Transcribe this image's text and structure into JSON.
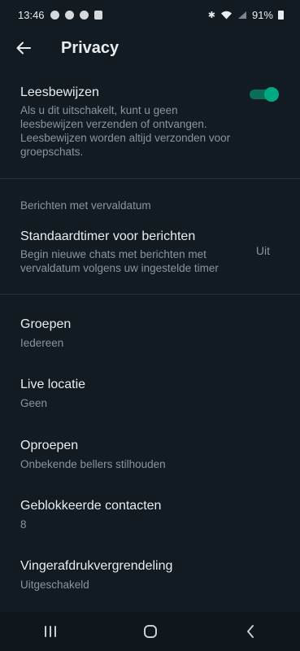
{
  "status": {
    "time": "13:46",
    "battery": "91%"
  },
  "header": {
    "title": "Privacy"
  },
  "read_receipts": {
    "title": "Leesbewijzen",
    "description": "Als u dit uitschakelt, kunt u geen leesbewijzen verzenden of ontvangen. Leesbewijzen worden altijd verzonden voor groepschats.",
    "enabled": true
  },
  "disappearing": {
    "section_label": "Berichten met vervaldatum",
    "title": "Standaardtimer voor berichten",
    "description": "Begin nieuwe chats met berichten met vervaldatum volgens uw ingestelde timer",
    "value": "Uit"
  },
  "items": [
    {
      "title": "Groepen",
      "value": "Iedereen"
    },
    {
      "title": "Live locatie",
      "value": "Geen"
    },
    {
      "title": "Oproepen",
      "value": "Onbekende bellers stilhouden"
    },
    {
      "title": "Geblokkeerde contacten",
      "value": "8"
    },
    {
      "title": "Vingerafdrukvergrendeling",
      "value": "Uitgeschakeld"
    }
  ],
  "colors": {
    "background": "#121b22",
    "accent": "#00a884",
    "secondary_text": "#8696a0"
  }
}
